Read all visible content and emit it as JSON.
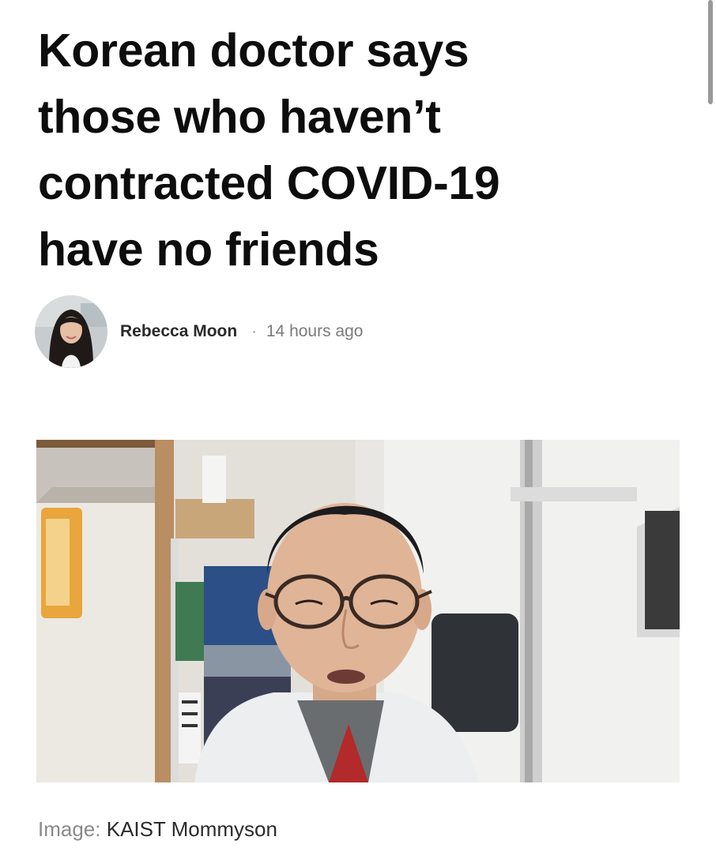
{
  "article": {
    "headline_lines": [
      "Korean doctor says",
      "those who haven’t",
      "contracted COVID-19",
      "have no friends"
    ]
  },
  "byline": {
    "author": "Rebecca Moon",
    "separator": "·",
    "time": "14 hours ago",
    "avatar_icon": "author-photo"
  },
  "hero": {
    "image_icon": "doctor-video-still"
  },
  "caption": {
    "label": "Image:",
    "credit": "KAIST Mommyson"
  },
  "colors": {
    "headline": "#0d0d0d",
    "author": "#2a2a2a",
    "meta": "#7b7b7b",
    "caption_label": "#8a8a8a"
  }
}
